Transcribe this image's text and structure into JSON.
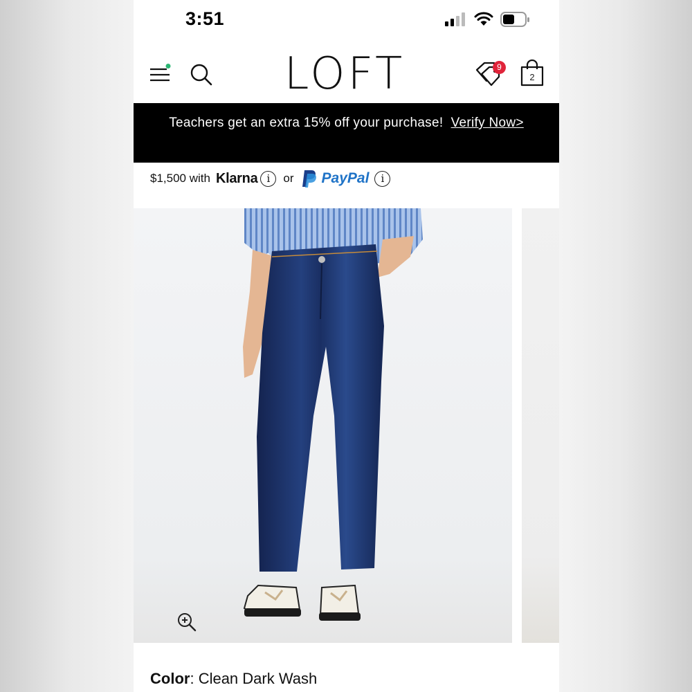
{
  "status_bar": {
    "time": "3:51"
  },
  "header": {
    "logo": "LOFT",
    "tags_badge": "9",
    "bag_count": "2"
  },
  "promo": {
    "text": "Teachers get an extra 15% off your purchase!",
    "link": "Verify Now>"
  },
  "payment": {
    "amount_text": "$1,500 with",
    "klarna": "Klarna",
    "or": "or",
    "paypal": "PayPal",
    "info": "i"
  },
  "product": {
    "color_label": "Color",
    "color_value": "Clean Dark Wash"
  },
  "colors": {
    "accent_badge": "#e0243a",
    "promo_bg": "#000000",
    "paypal_blue": "#1f73c7",
    "menu_dot": "#2bb673"
  },
  "icons": [
    "hamburger-icon",
    "search-icon",
    "tags-icon",
    "bag-icon",
    "zoom-in-icon",
    "info-icon",
    "paypal-icon"
  ]
}
